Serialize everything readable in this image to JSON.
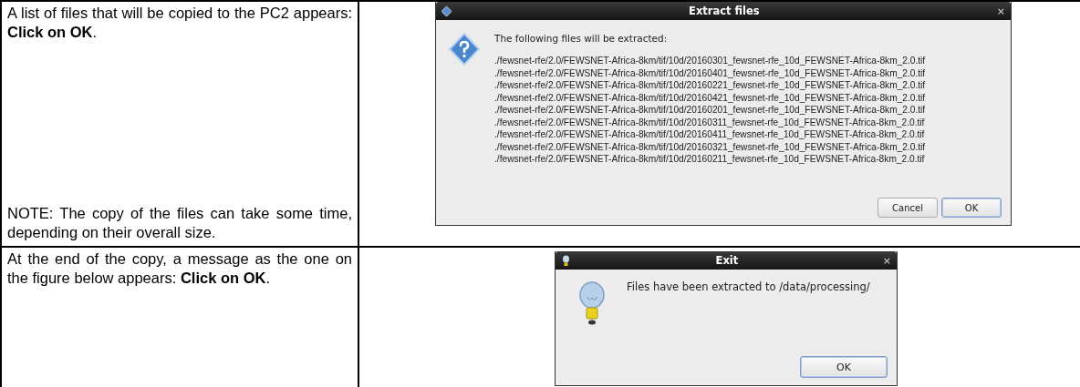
{
  "rows": [
    {
      "paragraphs": [
        "A list of files that will be copied to the PC2 appears: **Click on OK**.",
        "NOTE: The copy of the files can take some time, depending on their overall size."
      ],
      "dialog": {
        "title": "Extract files",
        "close_glyph": "×",
        "kind": "question",
        "message": "The following files will be extracted:",
        "files": [
          "./fewsnet-rfe/2.0/FEWSNET-Africa-8km/tif/10d/20160301_fewsnet-rfe_10d_FEWSNET-Africa-8km_2.0.tif",
          "./fewsnet-rfe/2.0/FEWSNET-Africa-8km/tif/10d/20160401_fewsnet-rfe_10d_FEWSNET-Africa-8km_2.0.tif",
          "./fewsnet-rfe/2.0/FEWSNET-Africa-8km/tif/10d/20160221_fewsnet-rfe_10d_FEWSNET-Africa-8km_2.0.tif",
          "./fewsnet-rfe/2.0/FEWSNET-Africa-8km/tif/10d/20160421_fewsnet-rfe_10d_FEWSNET-Africa-8km_2.0.tif",
          "./fewsnet-rfe/2.0/FEWSNET-Africa-8km/tif/10d/20160201_fewsnet-rfe_10d_FEWSNET-Africa-8km_2.0.tif",
          "./fewsnet-rfe/2.0/FEWSNET-Africa-8km/tif/10d/20160311_fewsnet-rfe_10d_FEWSNET-Africa-8km_2.0.tif",
          "./fewsnet-rfe/2.0/FEWSNET-Africa-8km/tif/10d/20160411_fewsnet-rfe_10d_FEWSNET-Africa-8km_2.0.tif",
          "./fewsnet-rfe/2.0/FEWSNET-Africa-8km/tif/10d/20160321_fewsnet-rfe_10d_FEWSNET-Africa-8km_2.0.tif",
          "./fewsnet-rfe/2.0/FEWSNET-Africa-8km/tif/10d/20160211_fewsnet-rfe_10d_FEWSNET-Africa-8km_2.0.tif"
        ],
        "buttons": [
          {
            "label": "Cancel",
            "focused": false
          },
          {
            "label": "OK",
            "focused": true
          }
        ]
      }
    },
    {
      "paragraphs": [
        "At the end of the copy, a message as the one on the figure below appears: **Click on OK**."
      ],
      "dialog": {
        "title": "Exit",
        "close_glyph": "×",
        "kind": "info",
        "message": "Files have been extracted to /data/processing/",
        "buttons": [
          {
            "label": "OK",
            "focused": true
          }
        ]
      }
    }
  ]
}
